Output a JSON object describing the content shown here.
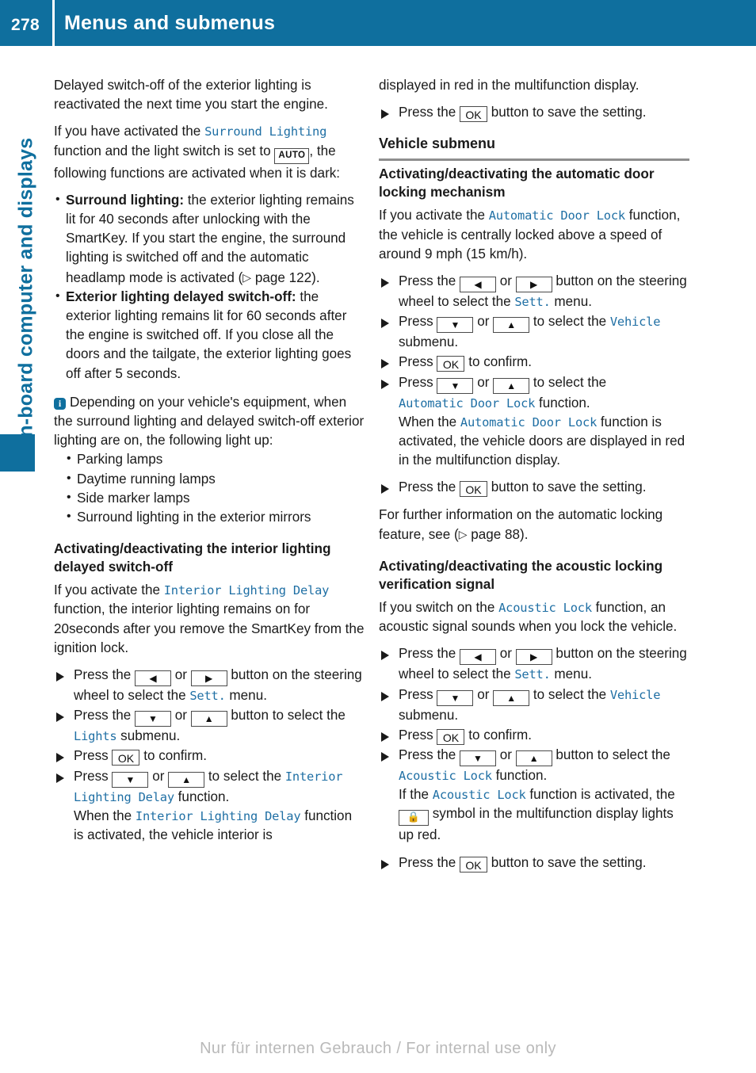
{
  "header": {
    "page_number": "278",
    "title": "Menus and submenus"
  },
  "sidebar": {
    "chapter_label": "On-board computer and displays"
  },
  "icons": {
    "info": "i",
    "auto": "AUTO",
    "ok": "OK",
    "arrow_left": "◀",
    "arrow_right": "▶",
    "arrow_down": "▼",
    "arrow_up": "▲",
    "lock": "🔒",
    "page_ref": "▷"
  },
  "left_column": {
    "para_1": "Delayed switch-off of the exterior lighting is reactivated the next time you start the engine.",
    "para_2_a": "If you have activated the ",
    "para_2_term": "Surround Lighting",
    "para_2_b": " function and the light switch is set to ",
    "para_2_c": ", the following functions are activated when it is dark:",
    "bullets": [
      {
        "lead": "Surround lighting:",
        "text_a": " the exterior lighting remains lit for 40 seconds after unlocking with the SmartKey. If you start the engine, the surround lighting is switched off and the automatic headlamp mode is activated (",
        "page_ref": " page 122",
        "text_b": ")."
      },
      {
        "lead": "Exterior lighting delayed switch-off:",
        "text_a": " the exterior lighting remains lit for 60 seconds after the engine is switched off. If you close all the doors and the tailgate, the exterior lighting goes off after 5 seconds.",
        "page_ref": "",
        "text_b": ""
      }
    ],
    "note_text": "Depending on your vehicle's equipment, when the surround lighting and delayed switch-off exterior lighting are on, the following light up:",
    "note_items": [
      "Parking lamps",
      "Daytime running lamps",
      "Side marker lamps",
      "Surround lighting in the exterior mirrors"
    ],
    "heading_interior": "Activating/deactivating the interior lighting delayed switch-off",
    "para_3_a": "If you activate the ",
    "para_3_term": "Interior Lighting Delay",
    "para_3_b": " function, the interior lighting remains on for 20seconds after you remove the SmartKey from the ignition lock.",
    "steps": [
      {
        "a": "Press the ",
        "b": " or ",
        "c": " button on the steering wheel to select the ",
        "term": "Sett.",
        "d": " menu."
      },
      {
        "a": "Press the ",
        "b": " or ",
        "c": " button to select the ",
        "term": "Lights",
        "d": " submenu."
      },
      {
        "a": "Press ",
        "b": "",
        "c": " to confirm.",
        "term": "",
        "d": ""
      },
      {
        "a": "Press ",
        "b": " or ",
        "c": " to select the ",
        "term": "Interior Lighting Delay",
        "d": " function."
      }
    ],
    "step4_line2_a": "When the ",
    "step4_line2_term": "Interior Lighting Delay",
    "step4_line2_b": " function is activated, the vehicle interior is"
  },
  "right_column": {
    "continued_text": "displayed in red in the multifunction display.",
    "step_save_a": "Press the ",
    "step_save_b": " button to save the setting.",
    "section_heading": "Vehicle submenu",
    "heading_door_lock": "Activating/deactivating the automatic door locking mechanism",
    "para_1_a": "If you activate the ",
    "para_1_term": "Automatic Door Lock",
    "para_1_b": " function, the vehicle is centrally locked above a speed of around 9 mph (15 km/h).",
    "steps_door": [
      {
        "a": "Press the ",
        "b": " or ",
        "c": " button on the steering wheel to select the ",
        "term": "Sett.",
        "d": " menu."
      },
      {
        "a": "Press ",
        "b": " or ",
        "c": " to select the ",
        "term": "Vehicle",
        "d": " submenu."
      },
      {
        "a": "Press ",
        "b": "",
        "c": " to confirm.",
        "term": "",
        "d": ""
      },
      {
        "a": "Press ",
        "b": " or ",
        "c": " to select the ",
        "term": "Automatic Door Lock",
        "d": " function."
      }
    ],
    "step_door_line2_a": "When the ",
    "step_door_line2_term": "Automatic Door Lock",
    "step_door_line2_b": " function is activated, the vehicle doors are displayed in red in the multifunction display.",
    "further_info_a": "For further information on the automatic locking feature, see (",
    "further_info_ref": " page 88",
    "further_info_b": ").",
    "heading_acoustic": "Activating/deactivating the acoustic locking verification signal",
    "para_2_a": "If you switch on the ",
    "para_2_term": "Acoustic Lock",
    "para_2_b": " function, an acoustic signal sounds when you lock the vehicle.",
    "steps_acoustic": [
      {
        "a": "Press the ",
        "b": " or ",
        "c": " button on the steering wheel to select the ",
        "term": "Sett.",
        "d": " menu."
      },
      {
        "a": "Press ",
        "b": " or ",
        "c": " to select the ",
        "term": "Vehicle",
        "d": " submenu."
      },
      {
        "a": "Press ",
        "b": "",
        "c": " to confirm.",
        "term": "",
        "d": ""
      },
      {
        "a": "Press the ",
        "b": " or ",
        "c": " button to select the ",
        "term": "Acoustic Lock",
        "d": " function."
      }
    ],
    "acoustic_line2_a": "If the ",
    "acoustic_line2_term": "Acoustic Lock",
    "acoustic_line2_b": " function is activated, the ",
    "acoustic_line2_c": " symbol in the multifunction display lights up red."
  },
  "footer": {
    "watermark": "Nur für internen Gebrauch / For internal use only"
  },
  "colors": {
    "brand_blue": "#0f6f9e",
    "term_blue": "#1f6fa4",
    "rule_gray": "#8e8e8e",
    "watermark_gray": "#b9b9b9"
  }
}
